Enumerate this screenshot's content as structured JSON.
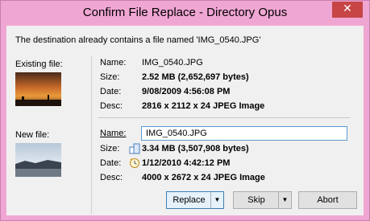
{
  "window": {
    "title": "Confirm File Replace - Directory Opus",
    "close_glyph": "✕",
    "accent": "#f0a6d3"
  },
  "message": "The destination already contains a file named 'IMG_0540.JPG'",
  "existing": {
    "section_label": "Existing file:",
    "name_label": "Name:",
    "name": "IMG_0540.JPG",
    "size_label": "Size:",
    "size": "2.52 MB (2,652,697 bytes)",
    "date_label": "Date:",
    "date": "9/08/2009 4:56:08 PM",
    "desc_label": "Desc:",
    "desc": "2816 x 2112 x 24 JPEG Image"
  },
  "new": {
    "section_label": "New file:",
    "name_label": "Name:",
    "name_value": "IMG_0540.JPG",
    "size_label": "Size:",
    "size": "3.34 MB (3,507,908 bytes)",
    "size_icon": "larger-file-icon",
    "date_label": "Date:",
    "date": "1/12/2010 4:42:12 PM",
    "date_icon": "newer-date-icon",
    "desc_label": "Desc:",
    "desc": "4000 x 2672 x 24 JPEG Image"
  },
  "buttons": {
    "replace": "Replace",
    "skip": "Skip",
    "abort": "Abort",
    "dropdown_glyph": "▼"
  }
}
